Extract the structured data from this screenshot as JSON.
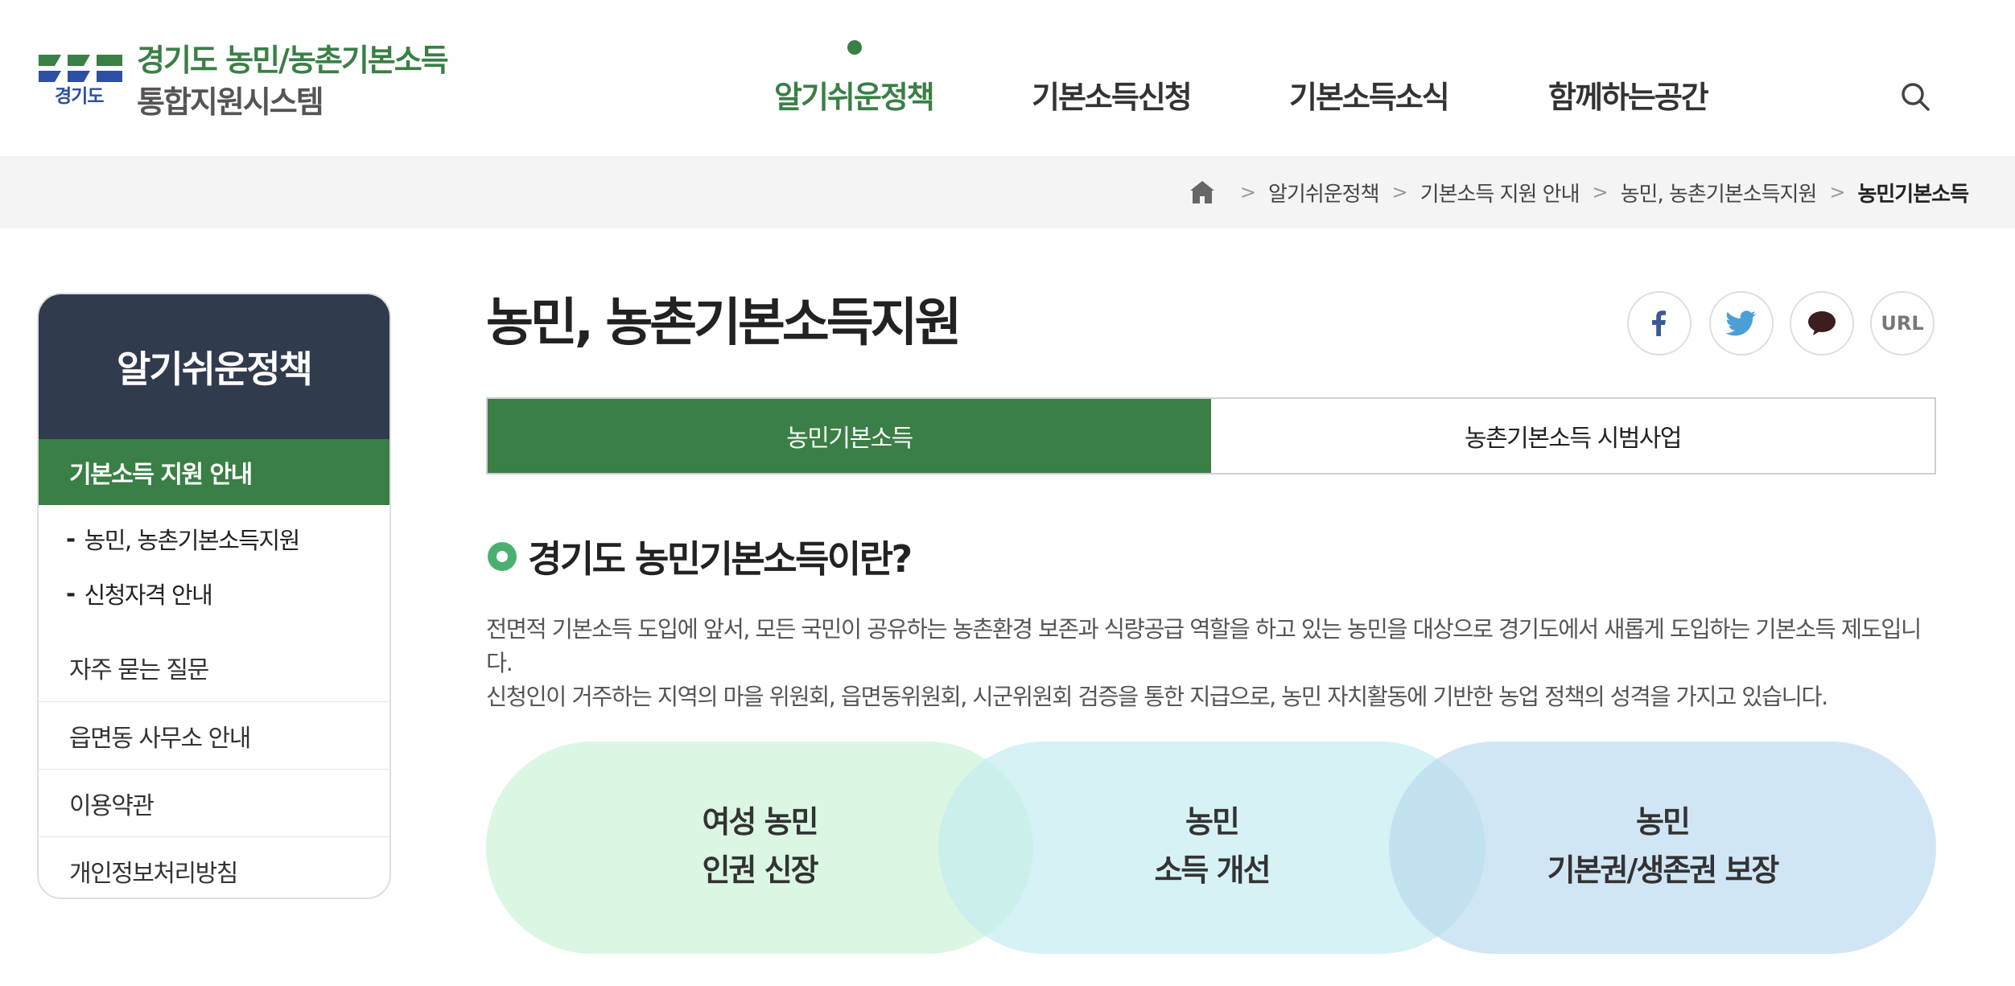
{
  "header": {
    "logo_mark_text": "경기도",
    "logo_title": "경기도 농민/농촌기본소득",
    "logo_subtitle": "통합지원시스템",
    "nav": [
      {
        "label": "알기쉬운정책",
        "active": true
      },
      {
        "label": "기본소득신청",
        "active": false
      },
      {
        "label": "기본소득소식",
        "active": false
      },
      {
        "label": "함께하는공간",
        "active": false
      }
    ],
    "search_icon": "search-icon",
    "brand_green": "#3a7f45",
    "brand_blue": "#2c4fa3"
  },
  "breadcrumb": {
    "home_icon": "home-icon",
    "items": [
      "알기쉬운정책",
      "기본소득 지원 안내",
      "농민, 농촌기본소득지원",
      "농민기본소득"
    ]
  },
  "sidebar": {
    "title": "알기쉬운정책",
    "active_section": "기본소득 지원 안내",
    "sub_items": [
      "농민, 농촌기본소득지원",
      "신청자격 안내"
    ],
    "items": [
      "자주 묻는 질문",
      "읍면동 사무소 안내",
      "이용약관",
      "개인정보처리방침"
    ],
    "header_color": "#313b4e"
  },
  "main": {
    "title": "농민, 농촌기본소득지원",
    "share": {
      "url_label": "URL",
      "icons": [
        "facebook-icon",
        "twitter-icon",
        "kakaotalk-icon"
      ]
    },
    "tabs": [
      {
        "label": "농민기본소득",
        "active": true
      },
      {
        "label": "농촌기본소득 시범사업",
        "active": false
      }
    ],
    "section_title": "경기도 농민기본소득이란?",
    "description": [
      "전면적 기본소득 도입에 앞서, 모든 국민이 공유하는 농촌환경 보존과 식량공급 역할을 하고 있는 농민을 대상으로 경기도에서 새롭게 도입하는 기본소득 제도입니다.",
      "신청인이 거주하는 지역의 마을 위원회, 읍면동위원회, 시군위원회 검증을 통한 지급으로, 농민 자치활동에 기반한 농업 정책의 성격을 가지고 있습니다."
    ],
    "goals": [
      {
        "line1": "여성 농민",
        "line2": "인권 신장"
      },
      {
        "line1": "농민",
        "line2": "소득 개선"
      },
      {
        "line1": "농민",
        "line2": "기본권/생존권 보장"
      }
    ]
  }
}
